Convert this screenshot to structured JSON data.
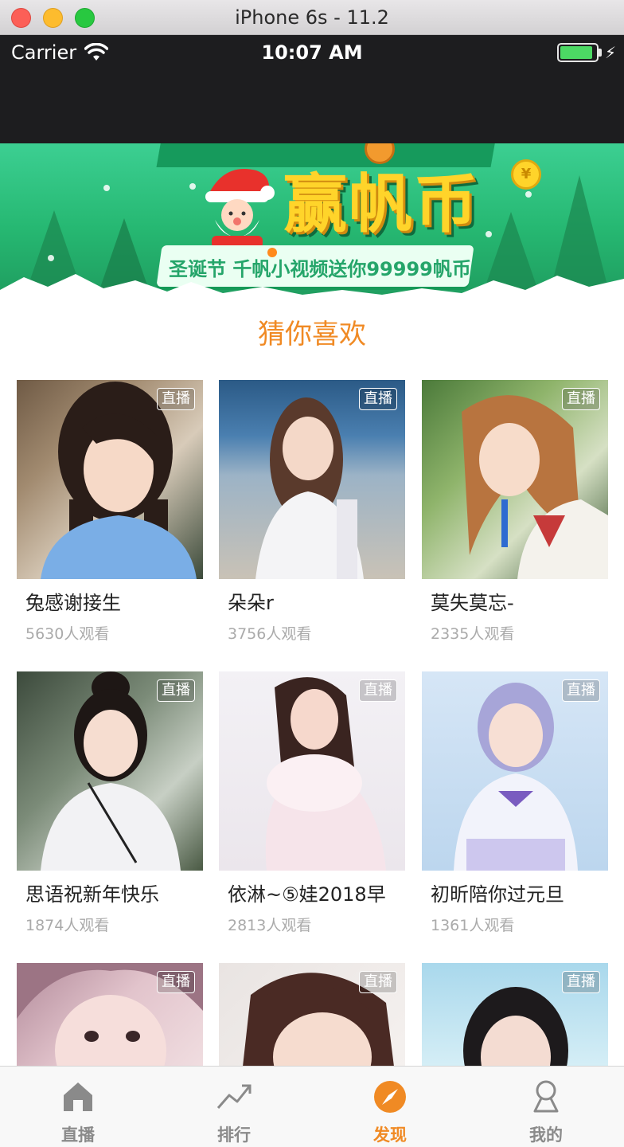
{
  "window": {
    "title": "iPhone 6s - 11.2"
  },
  "status_bar": {
    "carrier": "Carrier",
    "time": "10:07 AM"
  },
  "banner": {
    "headline": "赢帆币",
    "subtitle": "圣诞节 千帆小视频送你99999帆币",
    "coin_symbol": "¥"
  },
  "section": {
    "title": "猜你喜欢"
  },
  "colors": {
    "accent": "#f08a24",
    "tab_inactive": "#8a8a8a",
    "status_bar_bg": "#1d1d1f",
    "banner_green": "#26b872"
  },
  "streams": [
    {
      "badge": "直播",
      "name": "兔感谢接生",
      "viewers": "5630人观看"
    },
    {
      "badge": "直播",
      "name": "朵朵r",
      "viewers": "3756人观看"
    },
    {
      "badge": "直播",
      "name": "莫失莫忘-",
      "viewers": "2335人观看"
    },
    {
      "badge": "直播",
      "name": "思语祝新年快乐",
      "viewers": "1874人观看"
    },
    {
      "badge": "直播",
      "name": "依淋~⑤娃2018早",
      "viewers": "2813人观看"
    },
    {
      "badge": "直播",
      "name": "初昕陪你过元旦",
      "viewers": "1361人观看"
    },
    {
      "badge": "直播",
      "name": "",
      "viewers": ""
    },
    {
      "badge": "直播",
      "name": "",
      "viewers": ""
    },
    {
      "badge": "直播",
      "name": "",
      "viewers": ""
    }
  ],
  "tabs": [
    {
      "label": "直播",
      "icon": "home-icon",
      "active": false
    },
    {
      "label": "排行",
      "icon": "trend-chart-icon",
      "active": false
    },
    {
      "label": "发现",
      "icon": "compass-icon",
      "active": true
    },
    {
      "label": "我的",
      "icon": "user-profile-icon",
      "active": false
    }
  ]
}
